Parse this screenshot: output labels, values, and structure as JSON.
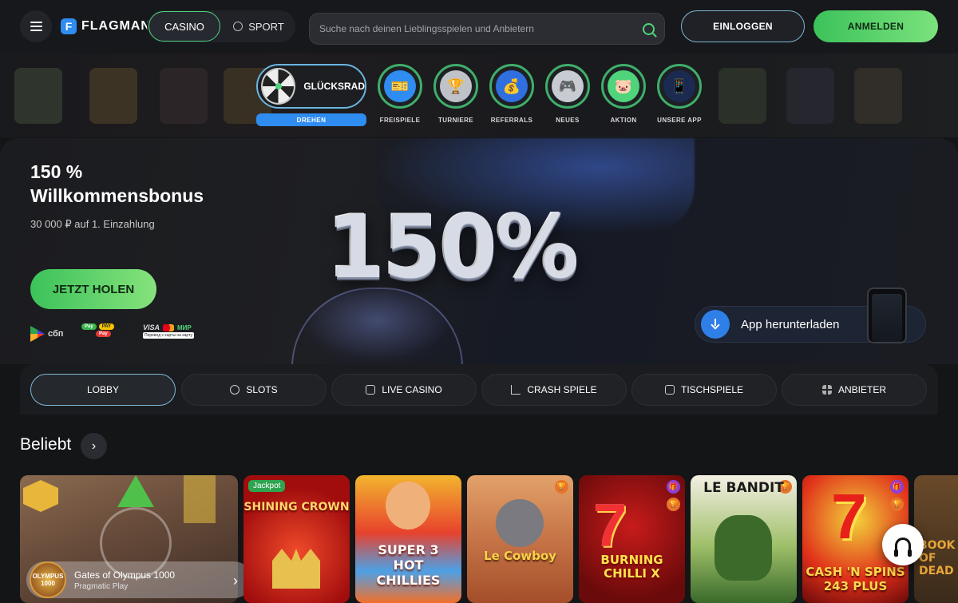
{
  "header": {
    "logo_text": "FLAGMAN",
    "logo_mark": "F",
    "casino_label": "CASINO",
    "sport_label": "SPORT",
    "search_placeholder": "Suche nach deinen Lieblingsspielen und Anbietern",
    "login_label": "EINLOGGEN",
    "register_label": "ANMELDEN"
  },
  "quicknav": {
    "wheel_label": "GLÜCKSRAD",
    "wheel_button": "DREHEN",
    "items": [
      {
        "label": "FREISPIELE",
        "icon": "ticket-icon",
        "color": "#2f8cf0"
      },
      {
        "label": "TURNIERE",
        "icon": "trophy-icon",
        "color": "#bfc3c9"
      },
      {
        "label": "REFERRALS",
        "icon": "money-bag-icon",
        "color": "#2f6fe0"
      },
      {
        "label": "NEUES",
        "icon": "gamepad-icon",
        "color": "#c8ccd2"
      },
      {
        "label": "AKTION",
        "icon": "piggy-bank-icon",
        "color": "#4fd47b"
      },
      {
        "label": "UNSERE APP",
        "icon": "phone-icon",
        "color": "#1a2a50"
      }
    ]
  },
  "banner": {
    "title_line1": "150 %",
    "title_line2": "Willkommensbonus",
    "subtitle": "30 000 ₽ auf 1. Einzahlung",
    "cta": "JETZT HOLEN",
    "promo_text": "150%",
    "payments": {
      "sbp": "сбп",
      "pay_pills": [
        "Pay",
        "PAY",
        "Pay"
      ],
      "visa": "VISA",
      "mir": "МИР",
      "transfer": "Перевод с карты на карту"
    },
    "app_download": "App herunterladen"
  },
  "tabs": [
    {
      "label": "LOBBY",
      "icon": "lobby-icon",
      "active": true
    },
    {
      "label": "SLOTS",
      "icon": "cherries-icon",
      "active": false
    },
    {
      "label": "LIVE CASINO",
      "icon": "live-icon",
      "active": false
    },
    {
      "label": "CRASH SPIELE",
      "icon": "chart-up-icon",
      "active": false
    },
    {
      "label": "TISCHSPIELE",
      "icon": "dice-icon",
      "active": false
    },
    {
      "label": "ANBIETER",
      "icon": "grid-icon",
      "active": false
    }
  ],
  "section": {
    "title": "Beliebt"
  },
  "featured": {
    "name": "Gates of Olympus 1000",
    "provider": "Pragmatic Play",
    "thumb_text": "OLYMPUS 1000"
  },
  "games": [
    {
      "title": "SHINING CROWN",
      "badge": "Jackpot"
    },
    {
      "title": "SUPER 3 HOT CHILLIES"
    },
    {
      "title": "Le Cowboy"
    },
    {
      "title": "BURNING CHILLI X"
    },
    {
      "title": "LE BANDIT"
    },
    {
      "title": "CASH 'N SPINS 243 PLUS"
    },
    {
      "title": "BOOK OF DEAD"
    }
  ]
}
